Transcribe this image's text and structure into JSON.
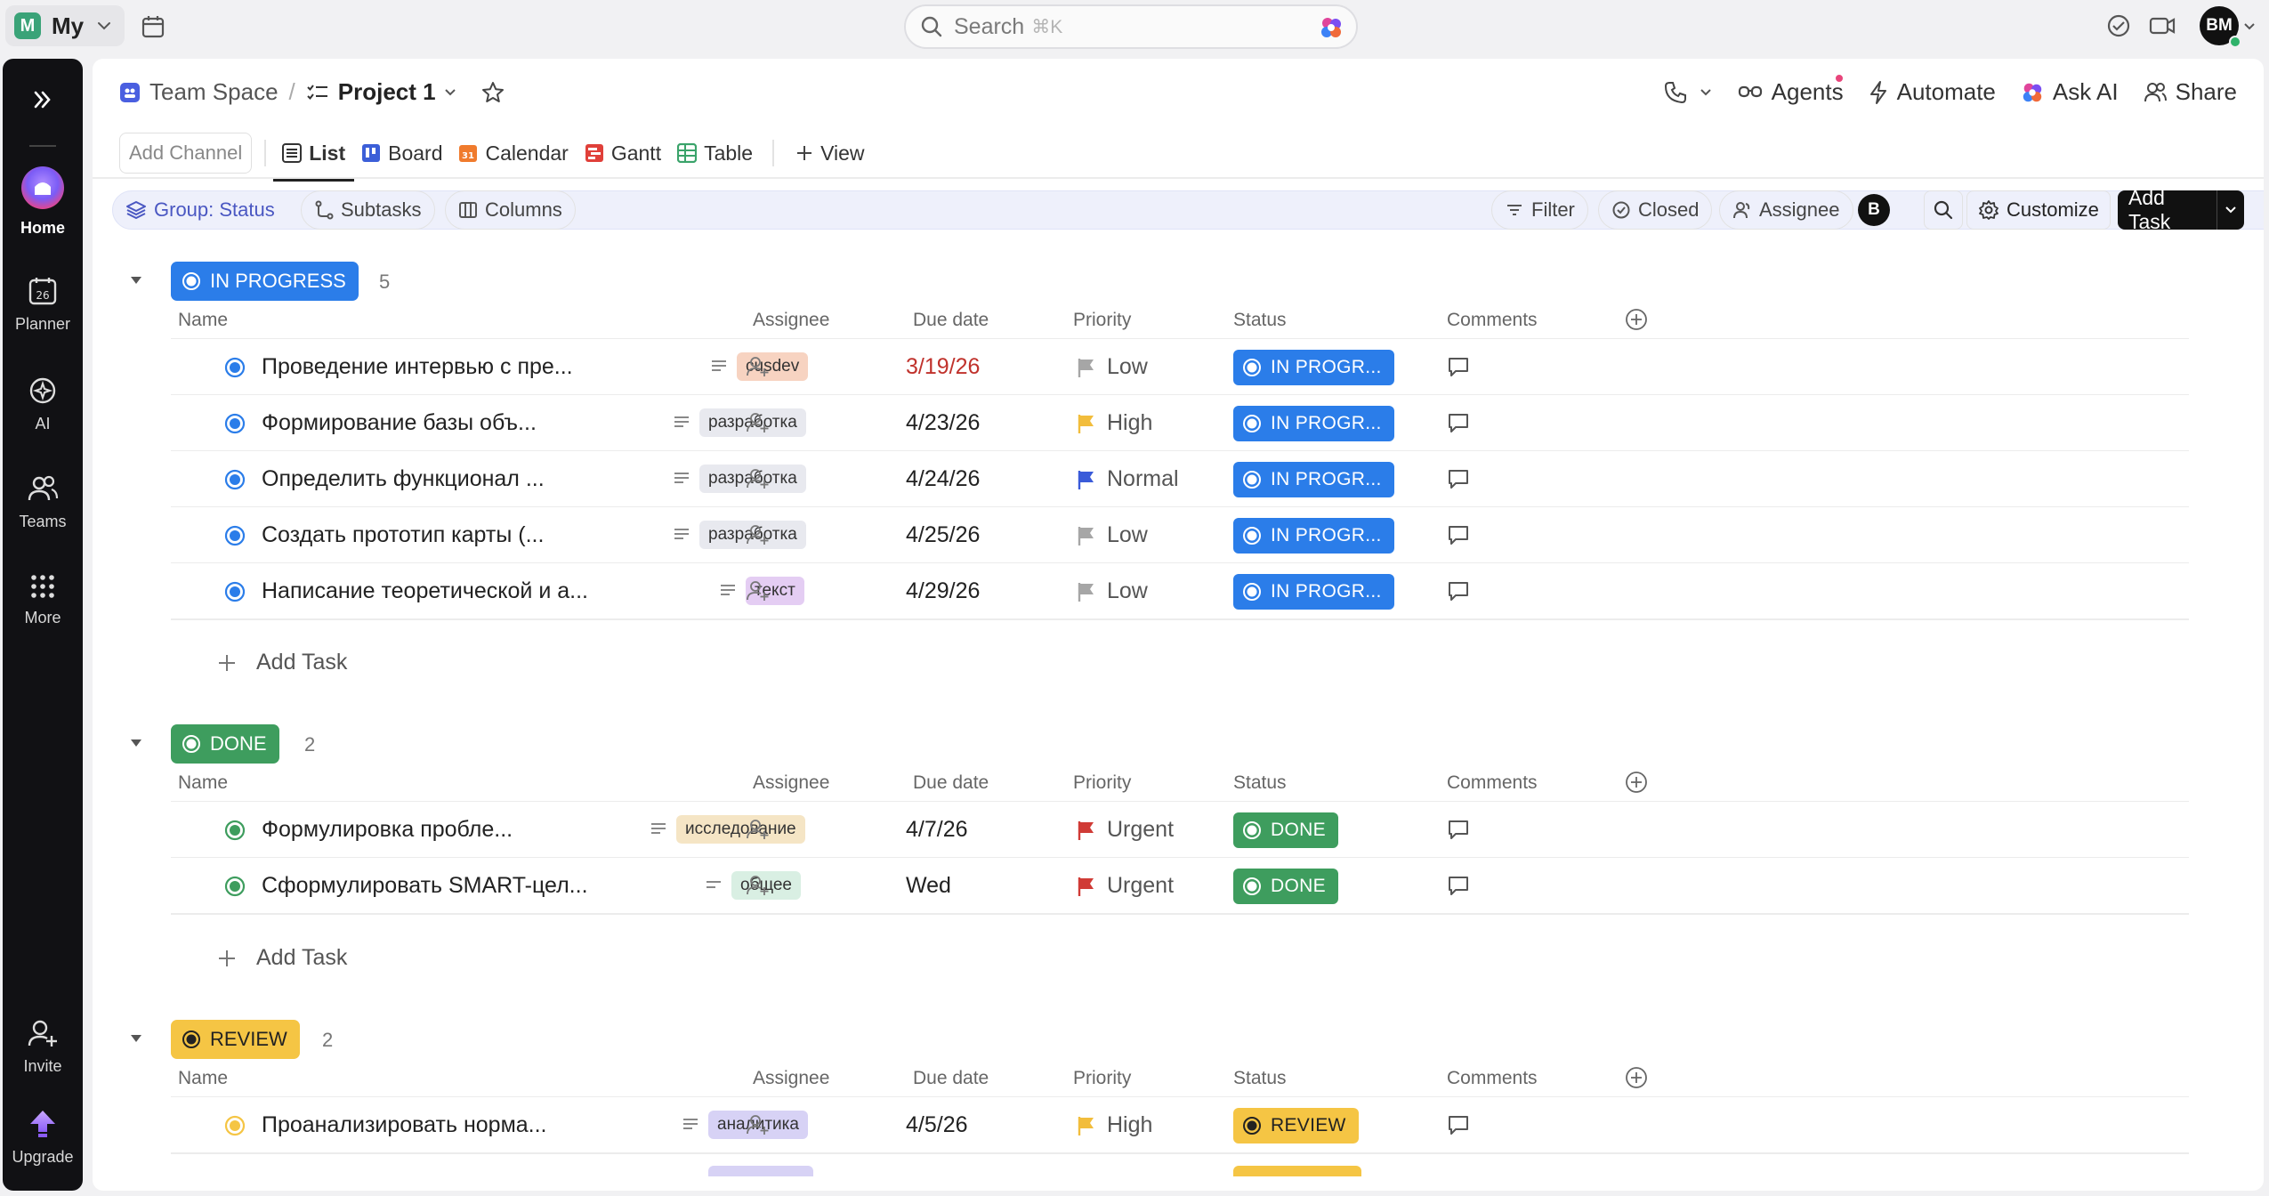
{
  "topbar": {
    "workspace_initial": "M",
    "workspace_name": "My",
    "search_placeholder": "Search",
    "search_shortcut": "⌘K",
    "user_initials": "BM"
  },
  "sidebar": {
    "items": [
      {
        "label": "Home"
      },
      {
        "label": "Planner"
      },
      {
        "label": "AI"
      },
      {
        "label": "Teams"
      },
      {
        "label": "More"
      },
      {
        "label": "Invite"
      },
      {
        "label": "Upgrade"
      }
    ],
    "planner_day": "26"
  },
  "header": {
    "space": "Team Space",
    "project": "Project 1",
    "actions": {
      "agents": "Agents",
      "automate": "Automate",
      "ask_ai": "Ask AI",
      "share": "Share"
    }
  },
  "views": {
    "add_channel": "Add Channel",
    "tabs": [
      {
        "label": "List"
      },
      {
        "label": "Board"
      },
      {
        "label": "Calendar"
      },
      {
        "label": "Gantt"
      },
      {
        "label": "Table"
      }
    ],
    "add_view": "View",
    "calendar_day": "31"
  },
  "toolbar": {
    "group": "Group: Status",
    "subtasks": "Subtasks",
    "columns": "Columns",
    "filter": "Filter",
    "closed": "Closed",
    "assignee": "Assignee",
    "me_initial": "B",
    "customize": "Customize",
    "add_task": "Add Task"
  },
  "columns": {
    "name": "Name",
    "assignee": "Assignee",
    "due": "Due date",
    "priority": "Priority",
    "status": "Status",
    "comments": "Comments"
  },
  "add_task_label": "Add Task",
  "groups": [
    {
      "status": "IN PROGRESS",
      "count": "5",
      "tasks": [
        {
          "name": "Проведение интервью с пре...",
          "tag": "cusdev",
          "due": "3/19/26",
          "priority": "Low",
          "status": "IN PROGR..."
        },
        {
          "name": "Формирование базы объ...",
          "tag": "разработка",
          "due": "4/23/26",
          "priority": "High",
          "status": "IN PROGR..."
        },
        {
          "name": "Определить функционал ...",
          "tag": "разработка",
          "due": "4/24/26",
          "priority": "Normal",
          "status": "IN PROGR..."
        },
        {
          "name": "Создать прототип карты (...",
          "tag": "разработка",
          "due": "4/25/26",
          "priority": "Low",
          "status": "IN PROGR..."
        },
        {
          "name": "Написание теоретической и а...",
          "tag": "текст",
          "due": "4/29/26",
          "priority": "Low",
          "status": "IN PROGR..."
        }
      ]
    },
    {
      "status": "DONE",
      "count": "2",
      "tasks": [
        {
          "name": "Формулировка пробле...",
          "tag": "исследование",
          "due": "4/7/26",
          "priority": "Urgent",
          "status": "DONE"
        },
        {
          "name": "Сформулировать SMART-цел...",
          "tag": "общее",
          "due": "Wed",
          "priority": "Urgent",
          "status": "DONE"
        }
      ]
    },
    {
      "status": "REVIEW",
      "count": "2",
      "tasks": [
        {
          "name": "Проанализировать норма...",
          "tag": "аналитика",
          "due": "4/5/26",
          "priority": "High",
          "status": "REVIEW"
        }
      ]
    }
  ],
  "colors": {
    "in_progress": "#2b7de9",
    "done": "#3e9d5e",
    "review": "#f5c544",
    "urgent_flag": "#d03b36",
    "high_flag": "#f2bd3c",
    "normal_flag": "#3a5bd9",
    "low_flag": "#a6a6a6",
    "overdue": "#c0322c"
  }
}
